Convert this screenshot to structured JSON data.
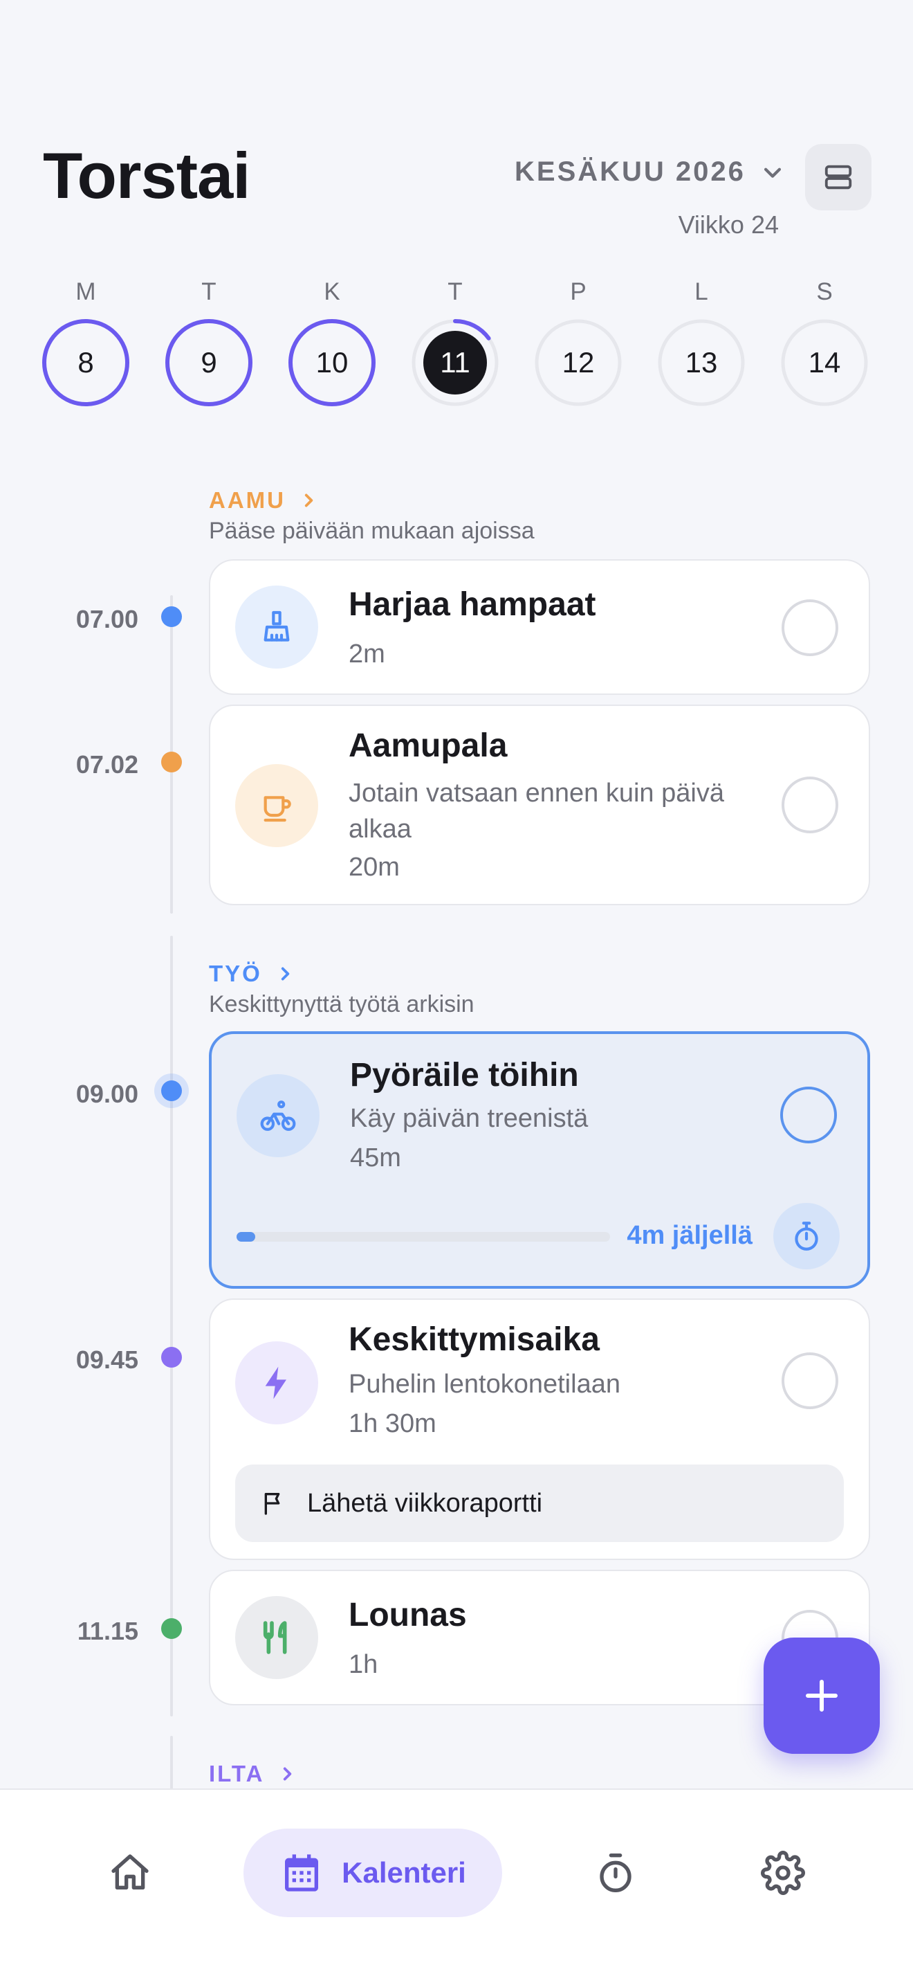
{
  "header": {
    "day_title": "Torstai",
    "month_label": "KESÄKUU 2026",
    "week_label": "Viikko 24"
  },
  "week": [
    {
      "letter": "M",
      "num": "8",
      "progress": 1.0
    },
    {
      "letter": "T",
      "num": "9",
      "progress": 1.0
    },
    {
      "letter": "K",
      "num": "10",
      "progress": 1.0
    },
    {
      "letter": "T",
      "num": "11",
      "progress": 0.15,
      "today": true
    },
    {
      "letter": "P",
      "num": "12",
      "progress": 0
    },
    {
      "letter": "L",
      "num": "13",
      "progress": 0
    },
    {
      "letter": "S",
      "num": "14",
      "progress": 0
    }
  ],
  "sections": {
    "aamu": {
      "title": "AAMU",
      "subtitle": "Pääse päivään mukaan ajoissa",
      "color": "#F0A04B"
    },
    "tyo": {
      "title": "TYÖ",
      "subtitle": "Keskittynyttä työtä arkisin",
      "color": "#4F8DF7"
    },
    "ilta": {
      "title": "ILTA",
      "color": "#8B6FF2"
    }
  },
  "tasks": [
    {
      "time": "07.00",
      "title": "Harjaa hampaat",
      "duration": "2m",
      "icon": "broom-icon",
      "color": "#4F8DF7"
    },
    {
      "time": "07.02",
      "title": "Aamupala",
      "description": "Jotain vatsaan ennen kuin päivä alkaa",
      "duration": "20m",
      "icon": "coffee-cup-icon",
      "color": "#F0A04B"
    },
    {
      "time": "09.00",
      "title": "Pyöräile töihin",
      "description": "Käy päivän treenistä",
      "duration": "45m",
      "icon": "bicycle-icon",
      "color": "#4F8DF7",
      "remaining": "4m jäljellä",
      "progress": 0.05
    },
    {
      "time": "09.45",
      "title": "Keskittymisaika",
      "description": "Puhelin lentokonetilaan",
      "duration": "1h 30m",
      "icon": "lightning-icon",
      "color": "#8B6FF2",
      "subtask": "Lähetä viikkoraportti"
    },
    {
      "time": "11.15",
      "title": "Lounas",
      "duration": "1h",
      "icon": "fork-knife-icon",
      "color": "#4CAF6A"
    }
  ],
  "nav": {
    "items": [
      "home-icon",
      "calendar-icon",
      "timer-icon",
      "gear-icon"
    ],
    "active_label": "Kalenteri"
  },
  "colors": {
    "accent": "#6B5AEF",
    "blue": "#4F8DF7"
  }
}
